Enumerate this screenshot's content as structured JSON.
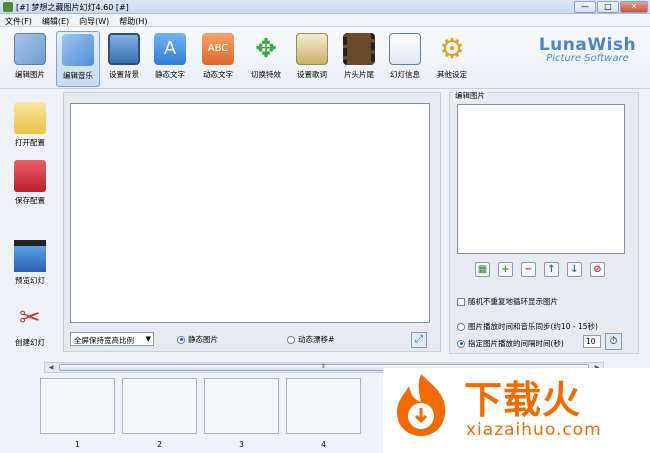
{
  "window": {
    "title": "[#] 梦想之藏图片幻灯4.60 [#]",
    "min": "—",
    "max": "□",
    "close": "✕"
  },
  "menu": [
    {
      "label": "文件(F)"
    },
    {
      "label": "编辑(E)"
    },
    {
      "label": "向导(W)"
    },
    {
      "label": "帮助(H)"
    }
  ],
  "toolbar": {
    "tools": [
      {
        "label": "编辑图片",
        "icon": "photo-edit-icon",
        "color": "#6f9ccf"
      },
      {
        "label": "编辑音乐",
        "icon": "music-icon",
        "color": "#4f8fd6"
      },
      {
        "label": "设置背景",
        "icon": "monitor-icon",
        "color": "#3c6fb3"
      },
      {
        "label": "静态文字",
        "icon": "text-a-icon",
        "color": "#2f7fd8"
      },
      {
        "label": "动态文字",
        "icon": "text-abc-icon",
        "color": "#e0692b"
      },
      {
        "label": "切换特效",
        "icon": "arrows-icon",
        "color": "#3aa84a"
      },
      {
        "label": "设置歌词",
        "icon": "lyrics-icon",
        "color": "#c9b26a"
      },
      {
        "label": "片头片尾",
        "icon": "film-icon",
        "color": "#6a4a2a"
      },
      {
        "label": "幻灯信息",
        "icon": "notepad-icon",
        "color": "#5f7fa8"
      },
      {
        "label": "其他设定",
        "icon": "gears-icon",
        "color": "#d9a21a"
      }
    ],
    "brand_line1": "LunaWish",
    "brand_line2": "Picture Software"
  },
  "sidebar": [
    {
      "label": "打开配置",
      "icon": "folder-open-icon"
    },
    {
      "label": "保存配置",
      "icon": "save-disk-icon"
    },
    {
      "label": "预览幻灯",
      "icon": "clapper-play-icon"
    },
    {
      "label": "创建幻灯",
      "icon": "tools-icon"
    }
  ],
  "preview": {
    "ratio_select": "全屏保持宽高比例",
    "radio_static": "静态图片",
    "radio_dynamic": "动态漂移#",
    "fit_icon": "⤢"
  },
  "image_panel": {
    "title": "编辑图片",
    "controls": [
      {
        "name": "grid-add",
        "glyph": "▦",
        "color": "#2f8a2f"
      },
      {
        "name": "add",
        "glyph": "+",
        "color": "#2f9a2f"
      },
      {
        "name": "remove",
        "glyph": "−",
        "color": "#d23a2a"
      },
      {
        "name": "move-up",
        "glyph": "↑",
        "color": "#2d6bc9"
      },
      {
        "name": "move-down",
        "glyph": "↓",
        "color": "#2d6bc9"
      },
      {
        "name": "delete",
        "glyph": "⊘",
        "color": "#c9302a"
      }
    ],
    "checkbox_random": "随机不重复地循环显示图片",
    "option_sync": "图片播放时间和音乐同步(约10 - 15秒)",
    "option_interval": "指定图片播放的间隔时间(秒)",
    "interval_value": "10"
  },
  "scrollbar": {
    "left": "◀",
    "right": "▶",
    "grip": "⦀"
  },
  "filmstrip": {
    "frames": [
      "1",
      "2",
      "3",
      "4"
    ]
  },
  "watermark": {
    "text_cn": "下载火",
    "text_en": "xiazaihuo.com"
  }
}
